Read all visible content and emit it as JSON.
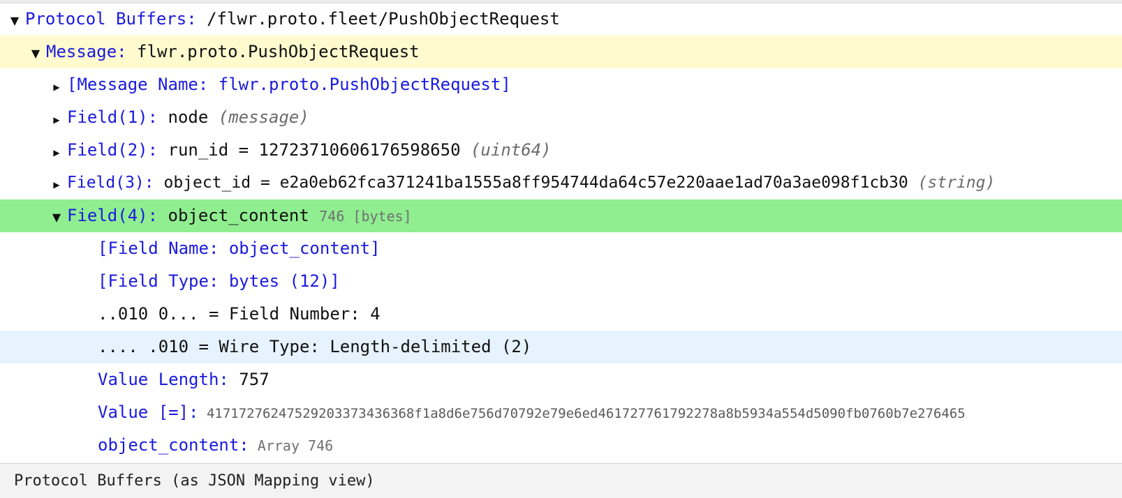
{
  "tree": {
    "root": {
      "key": "Protocol Buffers:",
      "value": " /flwr.proto.fleet/PushObjectRequest"
    },
    "message": {
      "key": "Message:",
      "value": " flwr.proto.PushObjectRequest"
    },
    "message_name": {
      "text": "[Message Name: flwr.proto.PushObjectRequest]"
    },
    "field1": {
      "key": "Field(1):",
      "value": " node ",
      "type": "(message)"
    },
    "field2": {
      "key": "Field(2):",
      "value": " run_id = 12723710606176598650 ",
      "type": "(uint64)"
    },
    "field3": {
      "key": "Field(3):",
      "value": " object_id = e2a0eb62fca371241ba1555a8ff954744da64c57e220aae1ad70a3ae098f1cb30 ",
      "type": "(string)"
    },
    "field4": {
      "key": "Field(4):",
      "value": " object_content ",
      "size": "746 [bytes]",
      "children": {
        "field_name": "[Field Name: object_content]",
        "field_type": "[Field Type: bytes (12)]",
        "field_number": "..010 0... = Field Number: 4",
        "wire_type": ".... .010 = Wire Type: Length-delimited (2)",
        "value_length_key": "Value Length:",
        "value_length": " 757",
        "value_key": "Value [=]:",
        "value_hex": " 4171727624752920337343636​8f1a8d6e756d70792e79e6ed461727761792278a8b5934a554d5090fb0760b7e276465",
        "content_key": "object_content:",
        "content_value": " Array 746"
      }
    }
  },
  "statusbar": {
    "text": "Protocol Buffers (as JSON Mapping view)"
  },
  "colors": {
    "key_blue": "#1a1adf",
    "row_yellow": "#fffbcf",
    "row_green": "#90ee90",
    "row_blue": "#e6f2fd"
  }
}
